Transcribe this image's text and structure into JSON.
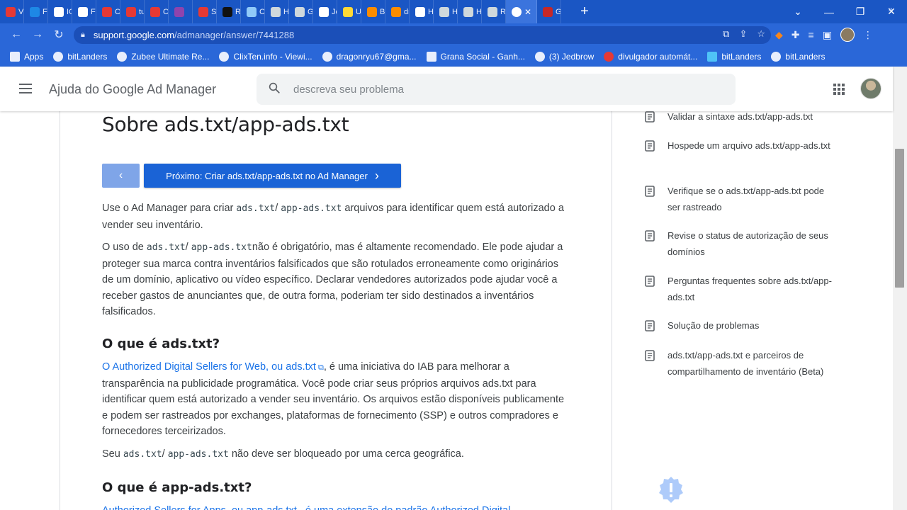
{
  "browser": {
    "tabs": [
      {
        "label": "V",
        "color": "#e53935"
      },
      {
        "label": "Fr",
        "color": "#1e88e5"
      },
      {
        "label": "IC",
        "color": "#ffffff"
      },
      {
        "label": "Fr",
        "color": "#ffffff"
      },
      {
        "label": "Cl",
        "color": "#e53935"
      },
      {
        "label": "tu",
        "color": "#e53935"
      },
      {
        "label": "Cl",
        "color": "#e53935"
      },
      {
        "label": "",
        "color": "#8e44ad"
      },
      {
        "label": "Se",
        "color": "#e53935"
      },
      {
        "label": "R",
        "color": "#111111"
      },
      {
        "label": "Cl",
        "color": "#90caf9"
      },
      {
        "label": "H",
        "color": "#cfd8dc"
      },
      {
        "label": "G",
        "color": "#cfd8dc"
      },
      {
        "label": "Jc",
        "color": "#ffffff"
      },
      {
        "label": "U",
        "color": "#fdd835"
      },
      {
        "label": "Bl",
        "color": "#fb8c00"
      },
      {
        "label": "dr",
        "color": "#fb8c00"
      },
      {
        "label": "H",
        "color": "#ffffff"
      },
      {
        "label": "H",
        "color": "#cfd8dc"
      },
      {
        "label": "H",
        "color": "#cfd8dc"
      },
      {
        "label": "Re",
        "color": "#cfd8dc"
      }
    ],
    "active_tab": {
      "label": "",
      "close": "✕"
    },
    "last_tab": {
      "label": "G",
      "color": "#c62828"
    },
    "new_tab": "+",
    "window_controls": {
      "dropdown": "⌄",
      "minimize": "—",
      "restore": "❐",
      "close": "✕"
    },
    "url_host": "support.google.com",
    "url_path": "/admanager/answer/7441288",
    "bookmarks": [
      {
        "label": "Apps",
        "icon": "apps-grid-icon"
      },
      {
        "label": "bitLanders",
        "icon": "globe-icon"
      },
      {
        "label": "Zubee Ultimate Re...",
        "icon": "globe-icon"
      },
      {
        "label": "ClixTen.info - Viewi...",
        "icon": "globe-icon"
      },
      {
        "label": "dragonryu67@gma...",
        "icon": "google-icon"
      },
      {
        "label": "Grana Social - Ganh...",
        "icon": "gs-icon"
      },
      {
        "label": "(3) Jedbrow",
        "icon": "globe-icon"
      },
      {
        "label": "divulgador automát...",
        "icon": "youtube-icon"
      },
      {
        "label": "bitLanders",
        "icon": "bitlanders-icon"
      },
      {
        "label": "bitLanders",
        "icon": "globe-icon"
      }
    ],
    "bookmarks_more": "»"
  },
  "header": {
    "title": "Ajuda do Google Ad Manager",
    "search_placeholder": "descreva seu problema"
  },
  "article": {
    "title": "Sobre ads.txt/app-ads.txt",
    "prev_label": "‹",
    "next_label": "Próximo: Criar ads.txt/app-ads.txt no Ad Manager",
    "next_chevron": "›",
    "p1": {
      "a": "Use o Ad Manager para criar ",
      "code1": "ads.txt",
      "b": "/ ",
      "code2": "app-ads.txt",
      "c": " arquivos para identificar quem está autorizado a vender seu inventário."
    },
    "p2": {
      "a": "O uso de ",
      "code1": "ads.txt",
      "b": "/ ",
      "code2": "app-ads.txt",
      "c": "não é obrigatório, mas é altamente recomendado. Ele pode ajudar a proteger sua marca contra inventários falsificados que são rotulados erroneamente como originários de um domínio, aplicativo ou vídeo específico. Declarar vendedores autorizados pode ajudar você a receber gastos de anunciantes que, de outra forma, poderiam ter sido destinados a inventários falsificados."
    },
    "h2_1": "O que é ads.txt?",
    "p3": {
      "link": "O Authorized Digital Sellers for Web, ou ads.txt",
      "rest": ", é uma iniciativa do IAB para melhorar a transparência na publicidade programática. Você pode criar seus próprios arquivos ads.txt para identificar quem está autorizado a vender seu inventário. Os arquivos estão disponíveis publicamente e podem ser rastreados por exchanges, plataformas de fornecimento (SSP) e outros compradores e fornecedores terceirizados."
    },
    "p4": {
      "a": "Seu ",
      "code1": "ads.txt",
      "b": "/ ",
      "code2": "app-ads.txt",
      "c": " não deve ser bloqueado por uma cerca geográfica."
    },
    "h2_2": "O que é app-ads.txt?",
    "p5_cut": "Authorized Sellers for Apps, ou app-ads.txt , é uma extensão do padrão Authorized Digital"
  },
  "toc": [
    "Validar a sintaxe ads.txt/app-ads.txt",
    "Hospede um arquivo ads.txt/app-ads.txt",
    "Verifique se o ads.txt/app-ads.txt pode ser rastreado",
    "Revise o status de autorização de seus domínios",
    "Perguntas frequentes sobre ads.txt/app-ads.txt",
    "Solução de problemas",
    "ads.txt/app-ads.txt e parceiros de compartilhamento de inventário (Beta)"
  ],
  "colors": {
    "accent": "#1a63d6",
    "link": "#1a73e8",
    "toc_icon": "#5f6368",
    "feedback_badge": "#aecbfa"
  }
}
